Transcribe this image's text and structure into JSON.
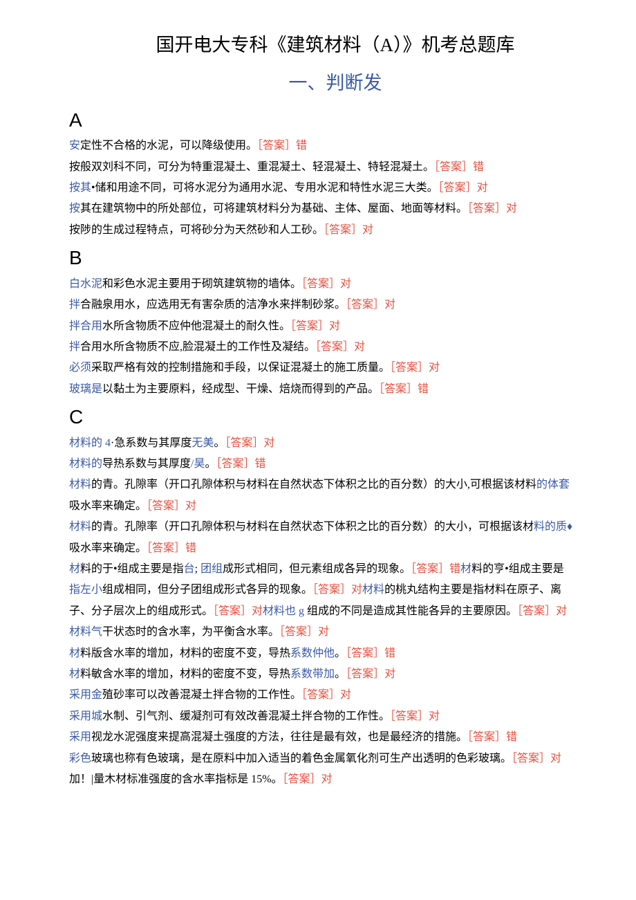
{
  "title": "国开电大专科《建筑材料（A）》机考总题库",
  "subtitle": "一、判断发",
  "sections": {
    "A": [
      {
        "segments": [
          {
            "t": "安",
            "c": "blue"
          },
          {
            "t": "定性不合格的水泥，可以降级使用。",
            "c": "black"
          },
          {
            "t": "［答案］错",
            "c": "red"
          }
        ]
      },
      {
        "segments": [
          {
            "t": "按般",
            "c": "black"
          },
          {
            "t": "双刘科不同，可分为特重混凝土、重混凝土、轻混凝土、特轻混凝土。",
            "c": "black"
          },
          {
            "t": "［答案］错",
            "c": "red"
          }
        ]
      },
      {
        "segments": [
          {
            "t": "按其",
            "c": "blue"
          },
          {
            "t": "•储和用途不同，可将水泥分为通用水泥、专用水泥和特性水泥三大类。",
            "c": "black"
          },
          {
            "t": "［答案］对",
            "c": "red"
          }
        ]
      },
      {
        "segments": [
          {
            "t": "按",
            "c": "blue"
          },
          {
            "t": "其在建筑物中的所处部位，可将建筑材料分为基础、主体、屋面、地面等材料。",
            "c": "black"
          },
          {
            "t": "［答案］对",
            "c": "red"
          }
        ]
      },
      {
        "segments": [
          {
            "t": "按陟",
            "c": "black"
          },
          {
            "t": "的生成过程特点，可将砂分为天然砂和人工砂。",
            "c": "black"
          },
          {
            "t": "［答案］对",
            "c": "red"
          }
        ]
      }
    ],
    "B": [
      {
        "segments": [
          {
            "t": "白水泥",
            "c": "blue"
          },
          {
            "t": "和彩色水泥主要用于砌筑建筑物的墙体。",
            "c": "black"
          },
          {
            "t": "［答案］对",
            "c": "red"
          }
        ]
      },
      {
        "segments": [
          {
            "t": "拌",
            "c": "blue"
          },
          {
            "t": "合融泉用水，应选用无有害杂质的洁净水来拌制砂浆。",
            "c": "black"
          },
          {
            "t": "［答案］对",
            "c": "red"
          }
        ]
      },
      {
        "segments": [
          {
            "t": "拌合用",
            "c": "blue"
          },
          {
            "t": "水所含物质不应仲他混凝土的耐久性。",
            "c": "black"
          },
          {
            "t": "［答案］对",
            "c": "red"
          }
        ]
      },
      {
        "segments": [
          {
            "t": "拌",
            "c": "blue"
          },
          {
            "t": "合用水所含物质不应,脸混凝土的工作性及凝结。",
            "c": "black"
          },
          {
            "t": "［答案］对",
            "c": "red"
          }
        ]
      },
      {
        "segments": [
          {
            "t": "必须",
            "c": "blue"
          },
          {
            "t": "采取严格有效的控制措施和手段，以保证混凝土的施工质量。",
            "c": "black"
          },
          {
            "t": "［答案］对",
            "c": "red"
          }
        ]
      },
      {
        "segments": [
          {
            "t": "玻璃是",
            "c": "blue"
          },
          {
            "t": "以黏土为主要原料，经成型、干燥、焙烧而得到的产品。",
            "c": "black"
          },
          {
            "t": "［答案］错",
            "c": "red"
          }
        ]
      }
    ],
    "C": [
      {
        "segments": [
          {
            "t": "材料的 4",
            "c": "blue"
          },
          {
            "t": "·急系数与其厚度",
            "c": "black"
          },
          {
            "t": "无美",
            "c": "blue"
          },
          {
            "t": "。",
            "c": "black"
          },
          {
            "t": "［答案］对",
            "c": "red"
          }
        ]
      },
      {
        "segments": [
          {
            "t": "材料的",
            "c": "blue"
          },
          {
            "t": "导热系数与其厚度",
            "c": "black"
          },
          {
            "t": "/昊",
            "c": "blue"
          },
          {
            "t": "。",
            "c": "black"
          },
          {
            "t": "［答案］错",
            "c": "red"
          }
        ]
      },
      {
        "segments": [
          {
            "t": "材料",
            "c": "blue"
          },
          {
            "t": "的青。孔隙率（开口孔隙体积与材料在自然状态下体积之比的百分数）的大小,可根据该材料",
            "c": "black"
          },
          {
            "t": "的体套",
            "c": "blue"
          },
          {
            "t": "吸水率来确定。",
            "c": "black"
          },
          {
            "t": "［答案］对",
            "c": "red"
          }
        ]
      },
      {
        "segments": [
          {
            "t": "材料",
            "c": "blue"
          },
          {
            "t": "的青。孔隙率（开口孔隙体积与材料在自然状态下体积之比的百分数）的大小，可根据该材",
            "c": "black"
          },
          {
            "t": "料的质♦",
            "c": "blue"
          },
          {
            "t": "吸水率来确定。",
            "c": "black"
          },
          {
            "t": "［答案］错",
            "c": "red"
          }
        ]
      },
      {
        "segments": [
          {
            "t": "材",
            "c": "blue"
          },
          {
            "t": "料的于•组成主要是指",
            "c": "black"
          },
          {
            "t": "台",
            "c": "blue"
          },
          {
            "t": "; ",
            "c": "black"
          },
          {
            "t": "团组",
            "c": "blue"
          },
          {
            "t": "成形式相同，但元素组成各异的现象。",
            "c": "black"
          },
          {
            "t": "［答案］错",
            "c": "red"
          },
          {
            "t": "材",
            "c": "blue"
          },
          {
            "t": "料的亨•组成主要是",
            "c": "black"
          },
          {
            "t": "指左小",
            "c": "blue"
          },
          {
            "t": "组成相同，但分子团组成形式各异的现象。",
            "c": "black"
          },
          {
            "t": "［答案］对",
            "c": "red"
          },
          {
            "t": "材料",
            "c": "blue"
          },
          {
            "t": "的桃丸结构主要是指材料在原子、离子、分子层次上的组成形式。",
            "c": "black"
          },
          {
            "t": "［答案］对",
            "c": "red"
          },
          {
            "t": "材料也 g ",
            "c": "blue"
          },
          {
            "t": "组成的不同是造成其性能各异的主要原因。",
            "c": "black"
          },
          {
            "t": "［答案］对",
            "c": "red"
          }
        ]
      },
      {
        "segments": [
          {
            "t": "材料气",
            "c": "blue"
          },
          {
            "t": "干状态时的含水率，为平衡含水率。",
            "c": "black"
          },
          {
            "t": "［答案］对",
            "c": "red"
          }
        ]
      },
      {
        "segments": [
          {
            "t": "材",
            "c": "blue"
          },
          {
            "t": "料版含水率的增加，材料的密度不变，导热",
            "c": "black"
          },
          {
            "t": "系数仲他",
            "c": "blue"
          },
          {
            "t": "。",
            "c": "black"
          },
          {
            "t": "［答案］错",
            "c": "red"
          }
        ]
      },
      {
        "segments": [
          {
            "t": "材",
            "c": "blue"
          },
          {
            "t": "料敏含水率的增加，材料的密度不变，导热",
            "c": "black"
          },
          {
            "t": "系数带加",
            "c": "blue"
          },
          {
            "t": "。",
            "c": "black"
          },
          {
            "t": "［答案］对",
            "c": "red"
          }
        ]
      },
      {
        "segments": [
          {
            "t": "采用金",
            "c": "blue"
          },
          {
            "t": "殖砂率可以改善混凝土拌合物的工作性。",
            "c": "black"
          },
          {
            "t": "［答案］对",
            "c": "red"
          }
        ]
      },
      {
        "segments": [
          {
            "t": "采用城",
            "c": "blue"
          },
          {
            "t": "水制、引气剂、缓凝剂可有效改善混凝土拌合物的工作性。",
            "c": "black"
          },
          {
            "t": "［答案］对",
            "c": "red"
          }
        ]
      },
      {
        "segments": [
          {
            "t": "采用",
            "c": "blue"
          },
          {
            "t": "视龙水泥强度来提高混凝土强度的方法，往往是最有效，也是最经济的措施。",
            "c": "black"
          },
          {
            "t": "［答案］错",
            "c": "red"
          }
        ]
      },
      {
        "segments": [
          {
            "t": "彩色",
            "c": "blue"
          },
          {
            "t": "玻璃也称有色玻璃，是在原料中加入适当的着色金属氧化剂可生产出透明的色彩玻璃。",
            "c": "black"
          },
          {
            "t": "［答案］对",
            "c": "red"
          },
          {
            "t": "加！|量木材标准强度的含水率指标是 15%。",
            "c": "black"
          },
          {
            "t": "［答案］对",
            "c": "red"
          }
        ]
      }
    ]
  }
}
